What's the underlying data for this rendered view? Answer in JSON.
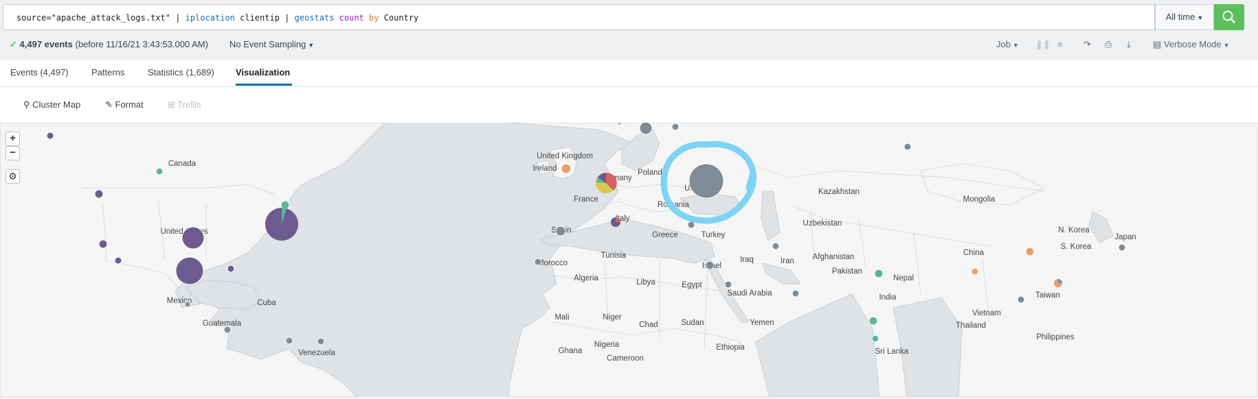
{
  "search": {
    "part_source": "source=\"apache_attack_logs.txt\"",
    "pipe1": " | ",
    "cmd_iplocation": "iplocation",
    "arg_clientip": " clientip",
    "pipe2": " | ",
    "cmd_geostats": "geostats",
    "fn_count": " count",
    "kw_by": " by",
    "arg_country": " Country",
    "time_range": "All time"
  },
  "meta": {
    "event_count": "4,497 events",
    "event_suffix": "(before 11/16/21 3:43:53.000 AM)",
    "sampling": "No Event Sampling",
    "job": "Job",
    "mode": "Verbose Mode"
  },
  "tabs": [
    {
      "label": "Events (4,497)"
    },
    {
      "label": "Patterns"
    },
    {
      "label": "Statistics (1,689)"
    },
    {
      "label": "Visualization"
    }
  ],
  "viz_toolbar": {
    "cluster_map": "Cluster Map",
    "format": "Format",
    "trellis": "Trellis"
  },
  "map": {
    "labels": [
      "Norway",
      "Canada",
      "United Kingdom",
      "Ireland",
      "Germany",
      "Poland",
      "Ukraine",
      "France",
      "Romania",
      "Kazakhstan",
      "Mongolia",
      "Italy",
      "Spain",
      "Uzbekistan",
      "United States",
      "Greece",
      "Turkey",
      "N. Korea",
      "S. Korea",
      "Japan",
      "Morocco",
      "Tunisia",
      "Israel",
      "Iraq",
      "Iran",
      "Afghanistan",
      "China",
      "Algeria",
      "Libya",
      "Egypt",
      "Pakistan",
      "Nepal",
      "Saudi Arabia",
      "India",
      "Taiwan",
      "Mexico",
      "Cuba",
      "Vietnam",
      "Mali",
      "Niger",
      "Chad",
      "Sudan",
      "Yemen",
      "Thailand",
      "Guatemala",
      "Philippines",
      "Nigeria",
      "Ethiopia",
      "Venezuela",
      "Ghana",
      "Sri Lanka",
      "Cameroon"
    ],
    "zoom_in": "+",
    "zoom_out": "−"
  }
}
